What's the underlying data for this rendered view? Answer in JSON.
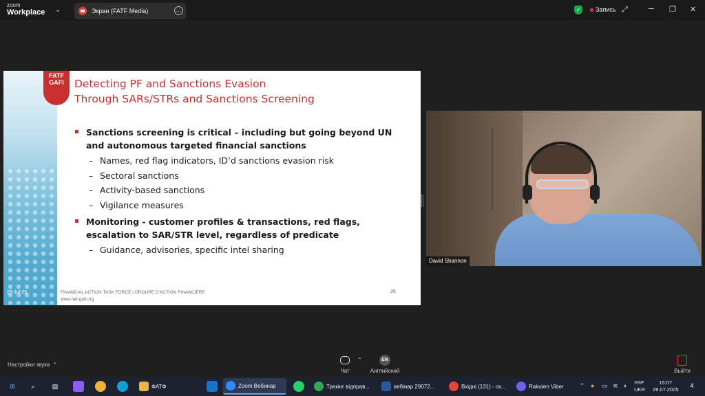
{
  "titlebar": {
    "logo_top": "zoom",
    "logo_bottom": "Workplace",
    "screen_tab_label": "Экран (FATF Media)",
    "more_icon": "…",
    "recording_label": "Запись",
    "icons": [
      "chevron-down-icon",
      "screen-share-icon",
      "more-icon",
      "shield-icon",
      "expand-icon",
      "minimize-icon",
      "maximize-icon",
      "close-icon"
    ]
  },
  "slide": {
    "logo_line1": "FATF",
    "logo_line2": "GAFI",
    "title_line1": "Detecting PF and Sanctions Evasion",
    "title_line2": "Through SARs/STRs and Sanctions Screening",
    "bullet1": "Sanctions screening is critical – including but going beyond UN and autonomous targeted financial sanctions",
    "sub1": [
      "Names, red flag indicators, ID’d sanctions evasion risk",
      "Sectoral sanctions",
      "Activity-based sanctions",
      "Vigilance measures"
    ],
    "bullet2": "Monitoring - customer profiles & transactions, red flags, escalation to SAR/STR level, regardless of predicate",
    "sub2": [
      "Guidance, advisories, specific intel sharing"
    ],
    "footer_date": "29-Jul-25",
    "footer_org": "FINANCIAL ACTION TASK FORCE | GROUPE D’ACTION FINANCIÈRE",
    "footer_url": "www.fatf-gafi.org",
    "page_number": "26"
  },
  "video": {
    "participant_name": "David Shannon"
  },
  "toolbar": {
    "sound_settings": "Настройки звука",
    "chat_label": "Чат",
    "lang_badge": "EN",
    "lang_label": "Английский",
    "exit_label": "Выйти"
  },
  "taskbar": {
    "apps": [
      {
        "label": "ФАТФ",
        "color": "#e8b64a"
      },
      {
        "label": "Zoom Вебинар",
        "color": "#2d8cff"
      },
      {
        "label": "Трекінг відправ...",
        "color": "#34a853"
      },
      {
        "label": "вебінар 29072...",
        "color": "#2b579a"
      },
      {
        "label": "Вхідні (131) - ov...",
        "color": "#ea4335"
      },
      {
        "label": "Rakuten Viber",
        "color": "#7360f2"
      }
    ],
    "lang_top": "УКР",
    "lang_bottom": "UKR",
    "time": "15:07",
    "date": "29.07.2025",
    "notifications": "4"
  }
}
